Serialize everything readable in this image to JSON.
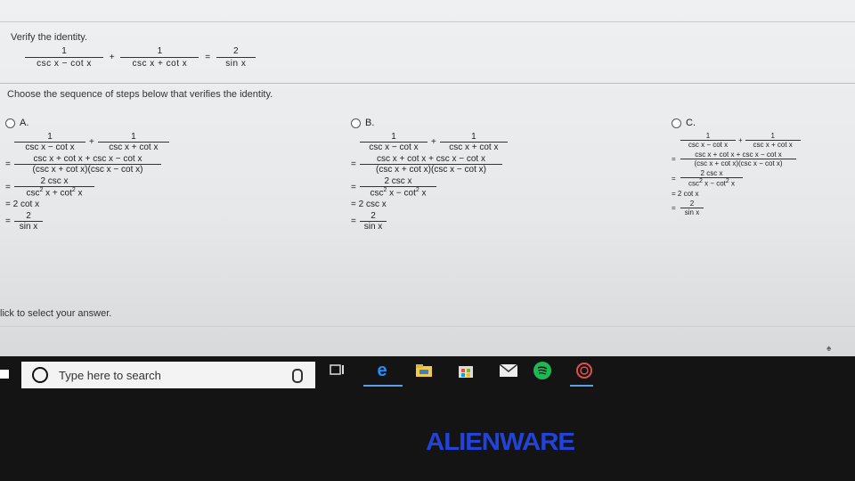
{
  "problem": {
    "prompt": "Verify the identity.",
    "lhs1_num": "1",
    "lhs1_den": "csc x − cot x",
    "plus": "+",
    "lhs2_num": "1",
    "lhs2_den": "csc x + cot x",
    "equals": "=",
    "rhs_num": "2",
    "rhs_den": "sin x"
  },
  "instruction": "Choose the sequence of steps below that verifies the identity.",
  "options": [
    {
      "label": "A.",
      "s1_num1": "1",
      "s1_den1": "csc x − cot x",
      "s1_num2": "1",
      "s1_den2": "csc x + cot x",
      "s2_num": "csc x + cot x + csc x − cot x",
      "s2_den": "(csc x + cot x)(csc x − cot x)",
      "s3_num": "2 csc x",
      "s3_den_a": "csc",
      "s3_sup1": "2",
      "s3_den_b": " x + cot",
      "s3_sup2": "2",
      "s3_den_c": " x",
      "s4": "= 2 cot x",
      "s5_num": "2",
      "s5_den": "sin x"
    },
    {
      "label": "B.",
      "s1_num1": "1",
      "s1_den1": "csc x − cot x",
      "s1_num2": "1",
      "s1_den2": "csc x + cot x",
      "s2_num": "csc x + cot x + csc x − cot x",
      "s2_den": "(csc x + cot x)(csc x − cot x)",
      "s3_num": "2 csc x",
      "s3_den_a": "csc",
      "s3_sup1": "2",
      "s3_den_b": " x − cot",
      "s3_sup2": "2",
      "s3_den_c": " x",
      "s4": "= 2 csc x",
      "s5_num": "2",
      "s5_den": "sin x"
    },
    {
      "label": "C.",
      "s1_num1": "1",
      "s1_den1": "csc x − cot x",
      "s1_num2": "1",
      "s1_den2": "csc x + cot x",
      "s2_num": "csc x + cot x + csc x − cot x",
      "s2_den": "(csc x + cot x)(csc x − cot x)",
      "s3_num": "2 csc x",
      "s3_den_a": "csc",
      "s3_sup1": "2",
      "s3_den_b": " x − cot",
      "s3_sup2": "2",
      "s3_den_c": " x",
      "s4": "= 2 cot x",
      "s5_num": "2",
      "s5_den": "sin x"
    }
  ],
  "footer": "lick to select your answer.",
  "taskbar": {
    "search_placeholder": "Type here to search"
  },
  "brand": "ALIENWARE",
  "colors": {
    "brand": "#2243d9",
    "taskbar": "#141414",
    "accent": "#5aa0e6"
  }
}
